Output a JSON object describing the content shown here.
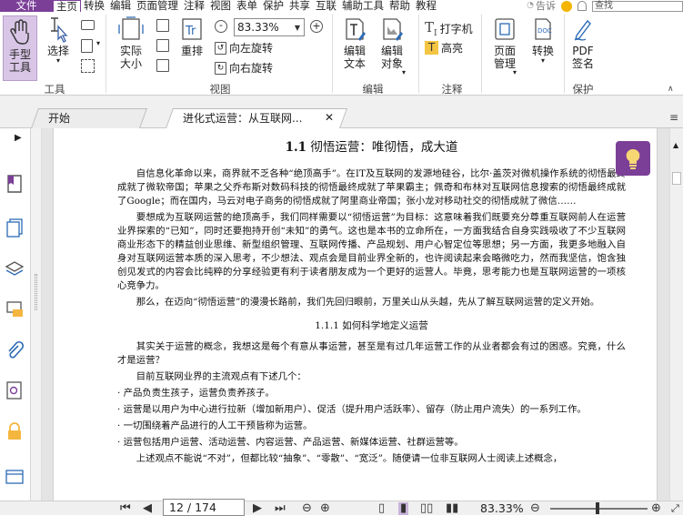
{
  "menu": {
    "file": "文件",
    "items": [
      "主页",
      "转换",
      "编辑",
      "页面管理",
      "注释",
      "视图",
      "表单",
      "保护",
      "共享",
      "互联",
      "辅助工具",
      "帮助",
      "教程"
    ],
    "tell_me": "告诉",
    "search_placeholder": "查找"
  },
  "ribbon": {
    "hand": "手型\n工具",
    "select": "选择",
    "group_tools": "工具",
    "actual_size": "实际\n大小",
    "reflow": "重排",
    "zoom_value": "83.33%",
    "rotate_left": "向左旋转",
    "rotate_right": "向右旋转",
    "group_view": "视图",
    "edit_text": "编辑\n文本",
    "edit_object": "编辑\n对象",
    "group_edit": "编辑",
    "typewriter": "打字机",
    "highlight": "高亮",
    "group_comment": "注释",
    "page_manage": "页面\n管理",
    "convert": "转换",
    "pdf_sign": "PDF\n签名",
    "group_protect": "保护"
  },
  "tabs": [
    {
      "label": "开始"
    },
    {
      "label": "进化式运营：从互联网..."
    }
  ],
  "document": {
    "title_num": "1.1",
    "title": "彻悟运营：唯彻悟，成大道",
    "para1": "自信息化革命以来，商界就不乏各种“绝顶高手”。在IT及互联网的发源地硅谷，比尔·盖茨对微机操作系统的彻悟最终成就了微软帝国；苹果之父乔布斯对数码科技的彻悟最终成就了苹果霸主；佩奇和布林对互联网信息搜索的彻悟最终成就了Google；而在国内，马云对电子商务的彻悟成就了阿里商业帝国；张小龙对移动社交的彻悟成就了微信……",
    "para2": "要想成为互联网运营的绝顶高手，我们同样需要以“彻悟运营”为目标：这意味着我们既要充分尊重互联网前人在运营业界探索的“已知”，同时还要抱持开创“未知”的勇气。这也是本书的立命所在，一方面我结合自身实践吸收了不少互联网商业形态下的精益创业思维、新型组织管理、互联网传播、产品规划、用户心智定位等思想；另一方面，我更多地融入自身对互联网运营本质的深入思考，不少想法、观点会是目前业界全新的，也许阅读起来会略微吃力，然而我坚信，饱含独创见发式的内容会比纯粹的分享经验更有利于读者朋友成为一个更好的运营人。毕竟，思考能力也是互联网运营的一项核心竞争力。",
    "para3": "那么，在迈向“彻悟运营”的漫漫长路前，我们先回归眼前，万里关山从头越，先从了解互联网运营的定义开始。",
    "section": "1.1.1 如何科学地定义运营",
    "para4": "其实关于运营的概念，我想这是每个有意从事运营，甚至是有过几年运营工作的从业者都会有过的困惑。究竟，什么才是运营？",
    "para5": "目前互联网业界的主流观点有下述几个：",
    "bullet1": "· 产品负责生孩子，运营负责养孩子。",
    "bullet2": "· 运营是以用户为中心进行拉新（增加新用户）、促活（提升用户活跃率）、留存（防止用户流失）的一系列工作。",
    "bullet3": "· 一切围绕着产品进行的人工干预皆称为运营。",
    "bullet4": "· 运营包括用户运营、活动运营、内容运营、产品运营、新媒体运营、社群运营等。",
    "para6": "上述观点不能说“不对”，但都比较“抽象”、“零散”、“宽泛”。随便请一位非互联网人士阅读上述概念，"
  },
  "status": {
    "page": "12 / 174",
    "zoom": "83.33%"
  },
  "colors": {
    "accent": "#7b3f98"
  }
}
